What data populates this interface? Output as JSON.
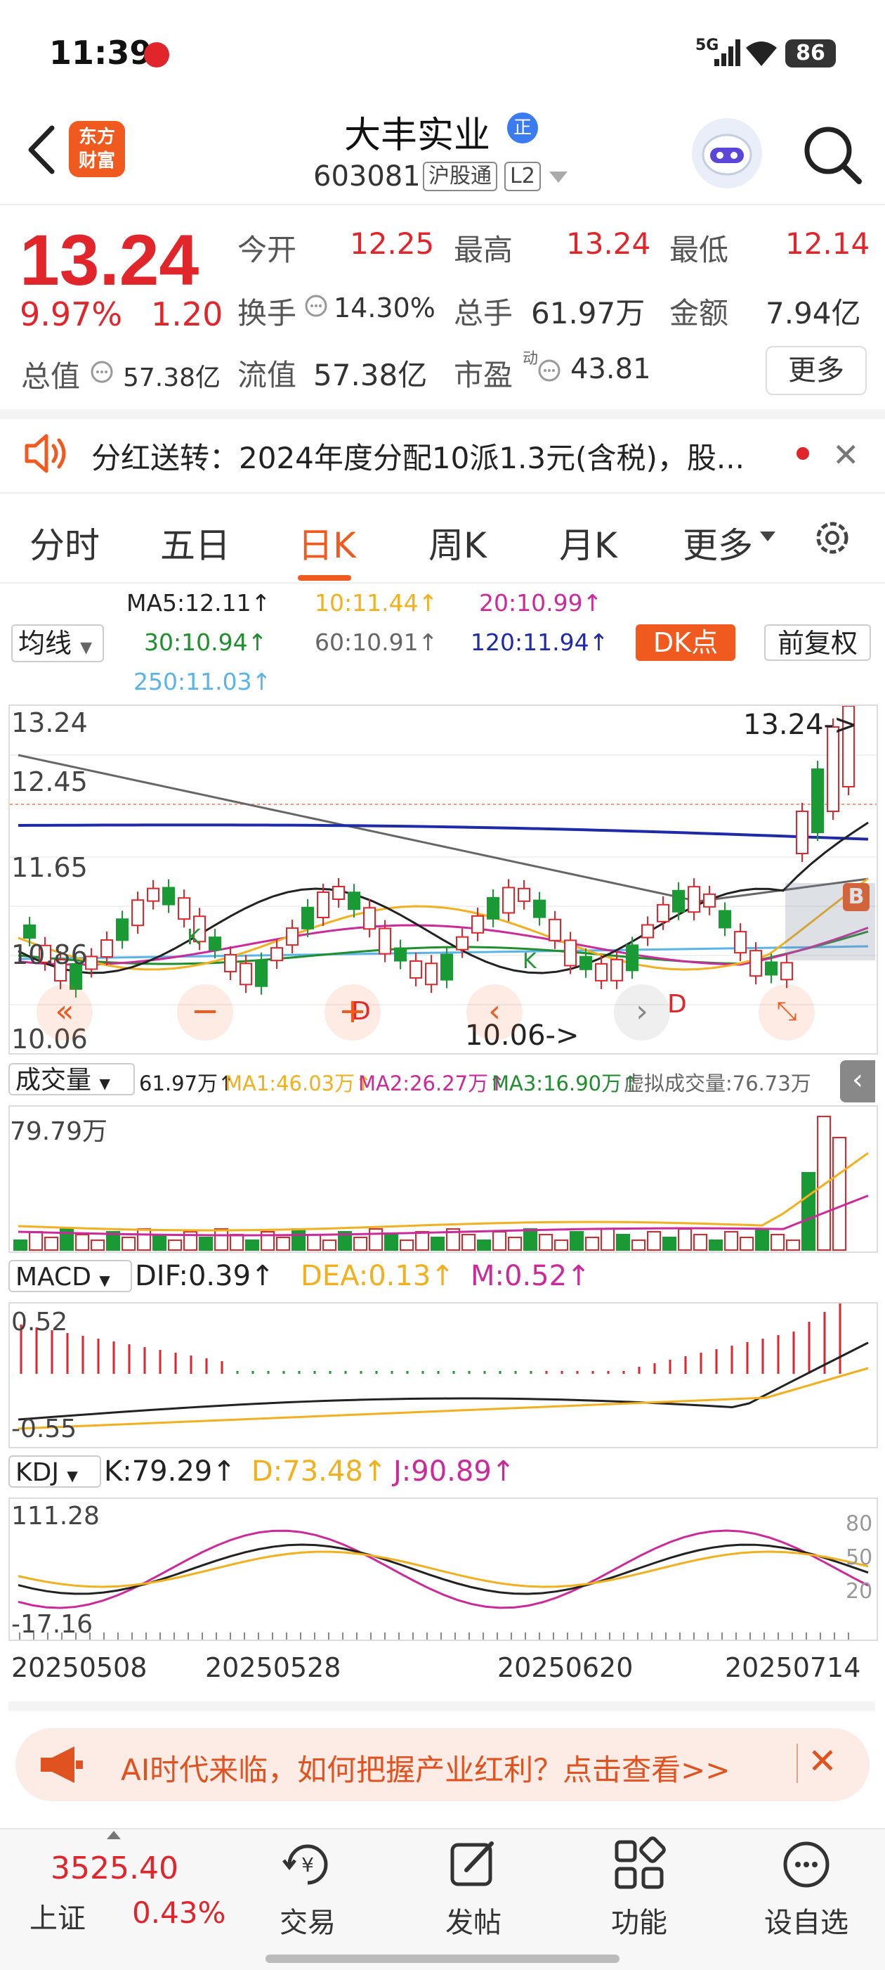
{
  "status_bar": {
    "time": "11:39",
    "network": "5G",
    "battery": "86"
  },
  "header": {
    "logo_line1": "东方",
    "logo_line2": "财富",
    "stock_name": "大丰实业",
    "badge": "正",
    "stock_code": "603081",
    "tag_connect": "沪股通",
    "tag_level": "L2"
  },
  "quote": {
    "price": "13.24",
    "change_pct": "9.97%",
    "change": "1.20",
    "open_label": "今开",
    "open": "12.25",
    "high_label": "最高",
    "high": "13.24",
    "low_label": "最低",
    "low": "12.14",
    "turnover_label": "换手",
    "turnover": "14.30%",
    "volume_label": "总手",
    "volume": "61.97万",
    "amount_label": "金额",
    "amount": "7.94亿",
    "mcap_label": "总值",
    "mcap": "57.38亿",
    "float_label": "流值",
    "float_cap": "57.38亿",
    "pe_label": "市盈",
    "pe_sup": "动",
    "pe": "43.81",
    "more": "更多"
  },
  "notice": {
    "text": "分红送转：2024年度分配10派1.3元(含税)，股..."
  },
  "tabs": [
    {
      "label": "分时"
    },
    {
      "label": "五日"
    },
    {
      "label": "日K"
    },
    {
      "label": "周K"
    },
    {
      "label": "月K"
    },
    {
      "label": "更多"
    }
  ],
  "ma_bar": {
    "select": "均线",
    "ma5": "MA5:12.11↑",
    "ma10": "10:11.44↑",
    "ma20": "20:10.99↑",
    "ma30": "30:10.94↑",
    "ma60": "60:10.91↑",
    "ma120": "120:11.94↑",
    "ma250": "250:11.03↑",
    "dk": "DK点",
    "adjust": "前复权"
  },
  "colors": {
    "up": "#e0252b",
    "down": "#1a9a34",
    "accent": "#f05a1e",
    "ma5": "#222222",
    "ma10": "#f2b01e",
    "ma20": "#cc2a9a",
    "ma30": "#1f8f2e",
    "ma60": "#666666",
    "ma120": "#1e2aa8",
    "ma250": "#5ab4e8"
  },
  "kline_pane": {
    "y_labels": [
      "13.24",
      "12.45",
      "11.65",
      "10.86",
      "10.06"
    ],
    "high_marker": "13.24->",
    "low_marker": "10.06->",
    "markers": [
      "K",
      "K",
      "D",
      "D"
    ],
    "buy_marker": "B"
  },
  "volume_pane": {
    "select": "成交量",
    "vol": "61.97万↑",
    "ma1": "MA1:46.03万↑",
    "ma2": "MA2:26.27万↑",
    "ma3": "MA3:16.90万↑",
    "virtual": "虚拟成交量:76.73万",
    "max_label": "79.79万"
  },
  "macd_pane": {
    "select": "MACD",
    "dif": "DIF:0.39↑",
    "dea": "DEA:0.13↑",
    "m": "M:0.52↑",
    "y_top": "0.52",
    "y_bottom": "-0.55"
  },
  "kdj_pane": {
    "select": "KDJ",
    "k": "K:79.29↑",
    "d": "D:73.48↑",
    "j": "J:90.89↑",
    "y_top": "111.28",
    "y_bottom": "-17.16",
    "levels": [
      "80",
      "50",
      "20"
    ]
  },
  "dates": [
    "20250508",
    "20250528",
    "20250620",
    "20250714"
  ],
  "chart_data": {
    "type": "candlestick",
    "y_range": [
      10.06,
      13.24
    ],
    "last_candle": {
      "open": 12.25,
      "high": 13.24,
      "low": 12.14,
      "close": 13.24
    }
  },
  "banner": {
    "text": "AI时代来临，如何把握产业红利？点击查看>>"
  },
  "bottom_nav": {
    "index_value": "3525.40",
    "index_name": "上证",
    "index_pct": "0.43%",
    "items": [
      {
        "label": "交易"
      },
      {
        "label": "发帖"
      },
      {
        "label": "功能"
      },
      {
        "label": "设自选"
      }
    ]
  }
}
